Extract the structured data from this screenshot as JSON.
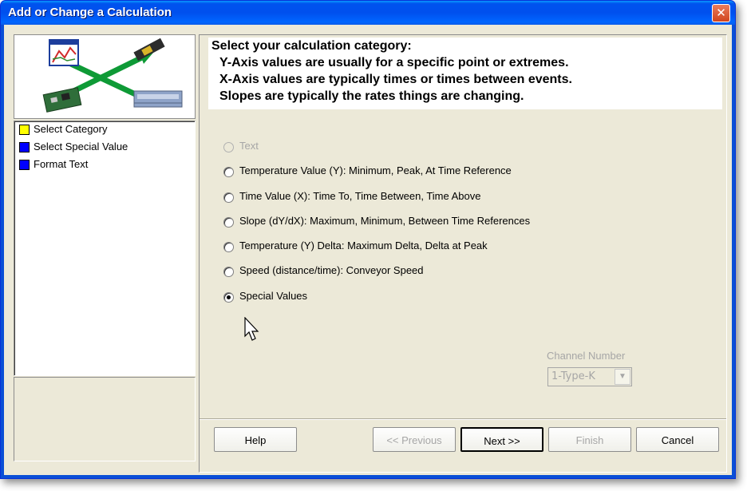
{
  "window": {
    "title": "Add or Change a Calculation",
    "close_glyph": "✕"
  },
  "steps": [
    {
      "label": "Select Category",
      "color": "#ffff00"
    },
    {
      "label": "Select Special Value",
      "color": "#0000ff"
    },
    {
      "label": "Format Text",
      "color": "#0000ff"
    }
  ],
  "header": {
    "line1": "Select your calculation category:",
    "line2": "Y-Axis values are usually for a specific point or extremes.",
    "line3": "X-Axis values are typically times or times between events.",
    "line4": "Slopes are typically the rates things are changing."
  },
  "options": [
    {
      "label": "Text",
      "disabled": true,
      "checked": false
    },
    {
      "label": "Temperature Value (Y):  Minimum, Peak, At Time Reference",
      "disabled": false,
      "checked": false
    },
    {
      "label": "Time Value (X):  Time To, Time Between, Time Above",
      "disabled": false,
      "checked": false
    },
    {
      "label": "Slope (dY/dX):  Maximum, Minimum, Between Time References",
      "disabled": false,
      "checked": false
    },
    {
      "label": "Temperature (Y) Delta:  Maximum Delta, Delta at Peak",
      "disabled": false,
      "checked": false
    },
    {
      "label": "Speed (distance/time): Conveyor Speed",
      "disabled": false,
      "checked": false
    },
    {
      "label": "Special  Values",
      "disabled": false,
      "checked": true
    }
  ],
  "channel": {
    "label": "Channel Number",
    "value": "1-Type-K",
    "arrow": "▼"
  },
  "buttons": {
    "help": "Help",
    "previous": "<< Previous",
    "next": "Next >>",
    "finish": "Finish",
    "cancel": "Cancel"
  }
}
